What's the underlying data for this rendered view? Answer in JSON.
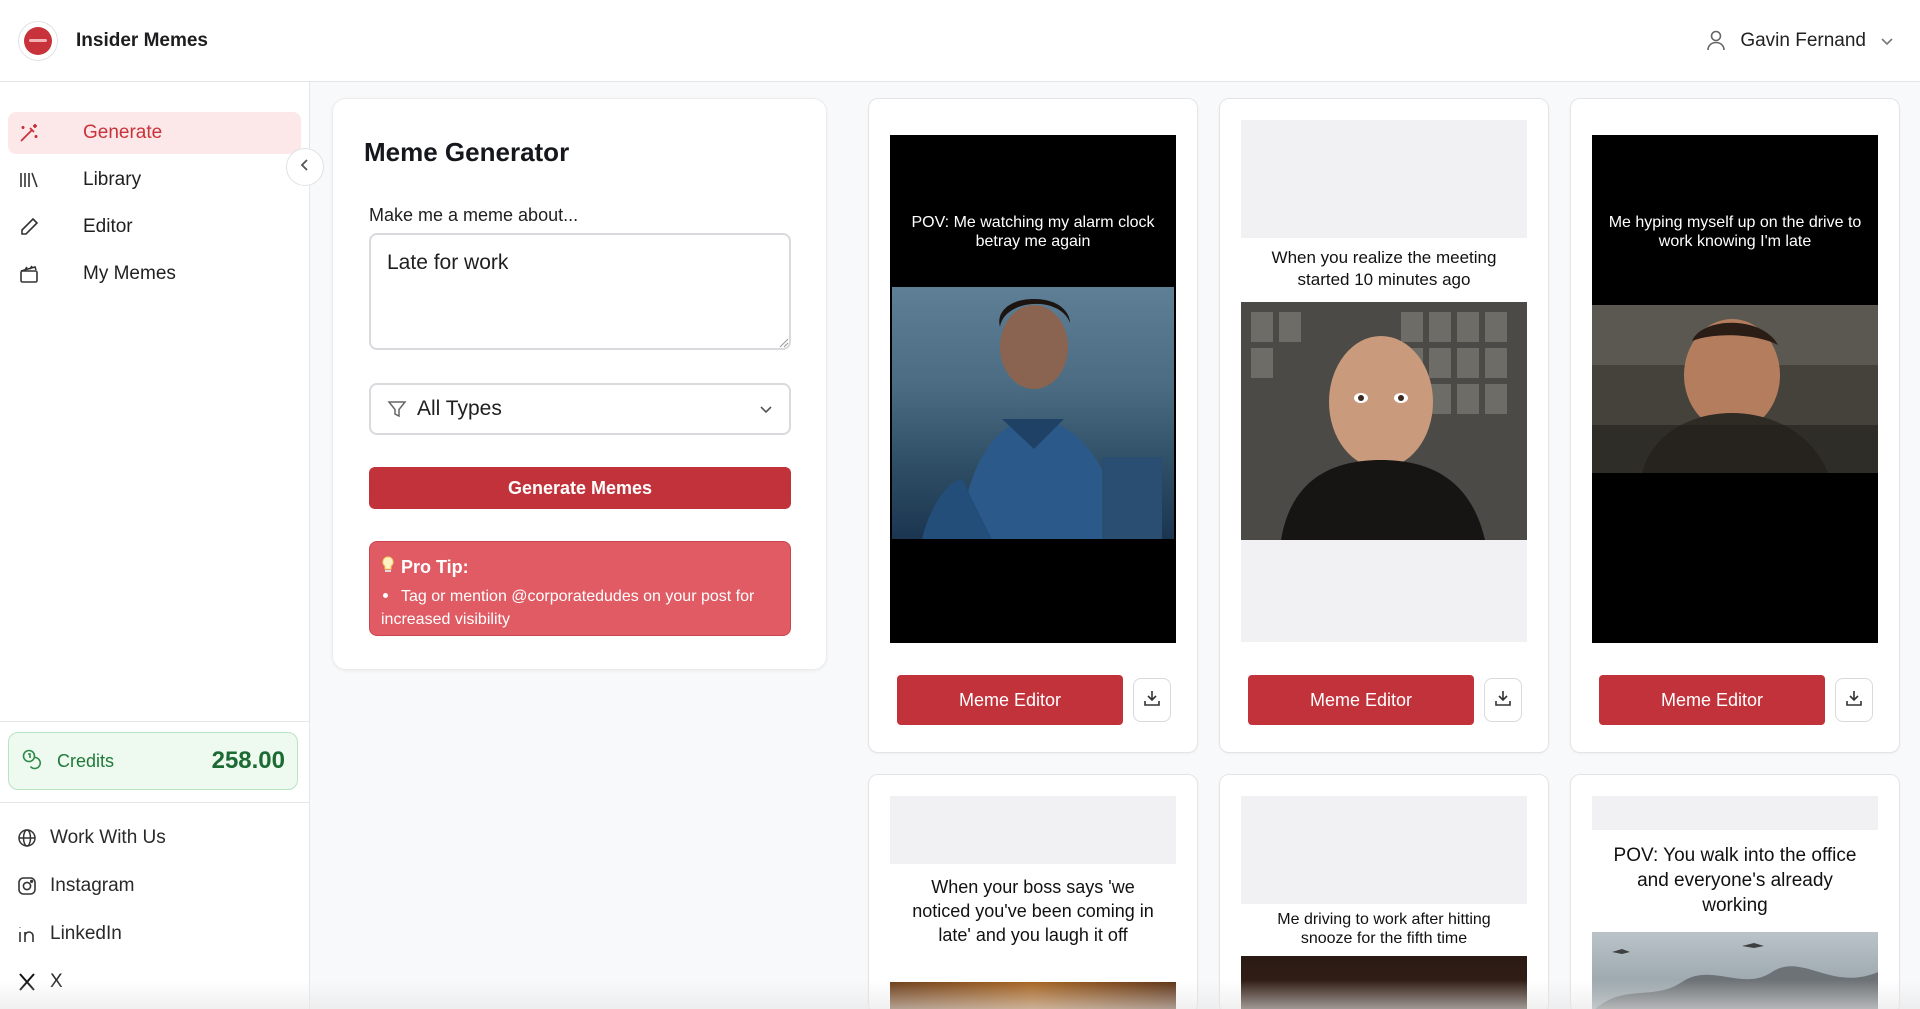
{
  "app": {
    "title": "Insider Memes"
  },
  "user": {
    "name": "Gavin Fernand"
  },
  "sidebar": {
    "items": [
      {
        "label": "Generate",
        "icon": "magic-wand-icon",
        "active": true
      },
      {
        "label": "Library",
        "icon": "library-icon"
      },
      {
        "label": "Editor",
        "icon": "pencil-icon"
      },
      {
        "label": "My Memes",
        "icon": "clapperboard-icon"
      }
    ],
    "credits": {
      "label": "Credits",
      "amount": "258.00"
    },
    "links": [
      {
        "label": "Work With Us",
        "icon": "globe-icon"
      },
      {
        "label": "Instagram",
        "icon": "instagram-icon"
      },
      {
        "label": "LinkedIn",
        "icon": "linkedin-icon"
      },
      {
        "label": "X",
        "icon": "x-logo-icon"
      }
    ]
  },
  "generator": {
    "title": "Meme Generator",
    "prompt_label": "Make me a meme about...",
    "prompt_value": "Late for work",
    "type_filter": "All Types",
    "generate_label": "Generate Memes",
    "tip_title": "Pro Tip:",
    "tip_text": "Tag or mention @corporatedudes on your post for increased visibility"
  },
  "memes": [
    {
      "caption": "POV: Me watching my alarm clock betray me again",
      "editor_label": "Meme Editor"
    },
    {
      "caption": "When you realize the meeting started 10 minutes ago",
      "editor_label": "Meme Editor"
    },
    {
      "caption": "Me hyping myself up on the drive to work knowing I'm late",
      "editor_label": "Meme Editor"
    },
    {
      "caption": "When your boss says 'we noticed you've been coming in late' and you laugh it off"
    },
    {
      "caption": "Me driving to work after hitting snooze for the fifth time"
    },
    {
      "caption": "POV: You walk into the office and everyone's already working"
    }
  ],
  "colors": {
    "accent": "#c1323a",
    "active_bg": "#fde8e9",
    "credits_bg": "#eef9f0",
    "tip_bg": "#e05b63"
  }
}
